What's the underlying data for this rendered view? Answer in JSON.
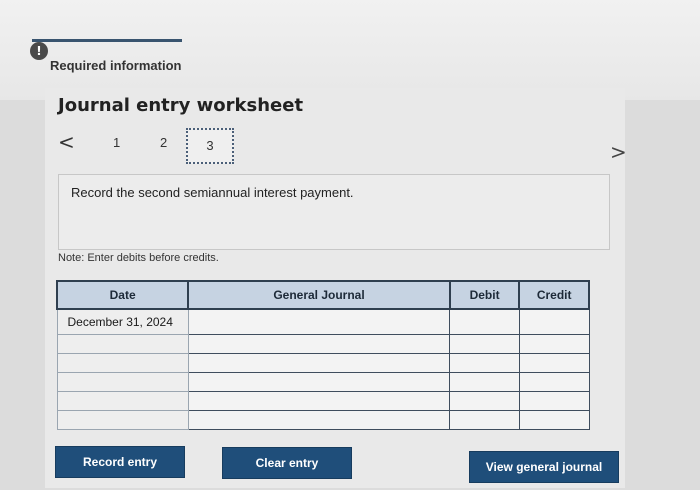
{
  "header": {
    "alert_icon": "!",
    "required_info": "Required information"
  },
  "worksheet": {
    "title": "Journal entry worksheet",
    "prev_glyph": "<",
    "next_glyph": ">",
    "steps": [
      "1",
      "2",
      "3"
    ],
    "active_step": "3",
    "instruction": "Record the second semiannual interest payment.",
    "note": "Note: Enter debits before credits."
  },
  "table": {
    "headers": [
      "Date",
      "General Journal",
      "Debit",
      "Credit"
    ],
    "rows": [
      [
        "December 31, 2024",
        "",
        "",
        ""
      ],
      [
        "",
        "",
        "",
        ""
      ],
      [
        "",
        "",
        "",
        ""
      ],
      [
        "",
        "",
        "",
        ""
      ],
      [
        "",
        "",
        "",
        ""
      ],
      [
        "",
        "",
        "",
        ""
      ]
    ]
  },
  "buttons": {
    "record": "Record entry",
    "clear": "Clear entry",
    "view": "View general journal"
  }
}
